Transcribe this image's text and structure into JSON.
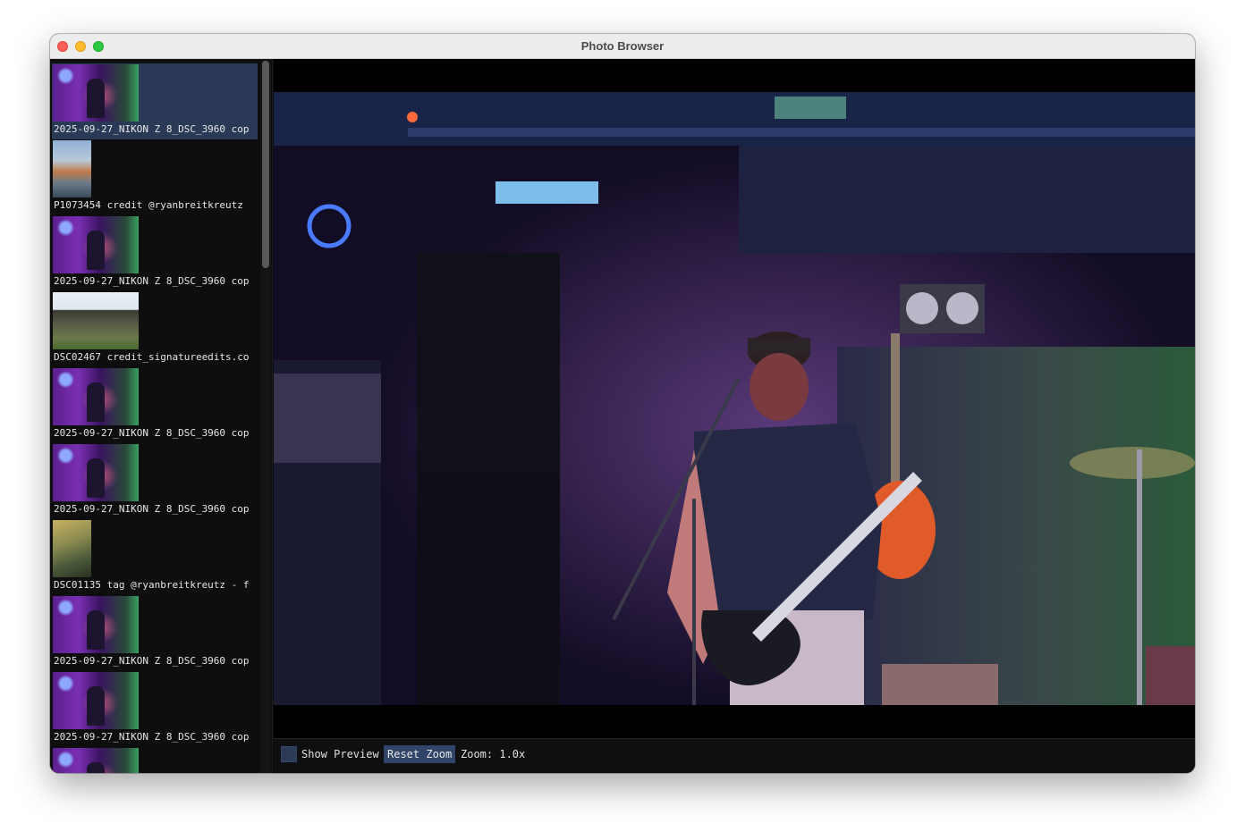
{
  "window": {
    "title": "Photo Browser"
  },
  "sidebar": {
    "items": [
      {
        "label": "2025-09-27_NIKON Z 8_DSC_3960 cop",
        "thumb": "concert",
        "selected": true
      },
      {
        "label": "P1073454 credit @ryanbreitkreutz",
        "thumb": "mountain",
        "selected": false
      },
      {
        "label": "2025-09-27_NIKON Z 8_DSC_3960 cop",
        "thumb": "concert",
        "selected": false
      },
      {
        "label": "DSC02467 credit_signatureedits.co",
        "thumb": "temple",
        "selected": false
      },
      {
        "label": "2025-09-27_NIKON Z 8_DSC_3960 cop",
        "thumb": "concert",
        "selected": false
      },
      {
        "label": "2025-09-27_NIKON Z 8_DSC_3960 cop",
        "thumb": "concert",
        "selected": false
      },
      {
        "label": "DSC01135 tag @ryanbreitkreutz - f",
        "thumb": "forest",
        "selected": false
      },
      {
        "label": "2025-09-27_NIKON Z 8_DSC_3960 cop",
        "thumb": "concert",
        "selected": false
      },
      {
        "label": "2025-09-27_NIKON Z 8_DSC_3960 cop",
        "thumb": "concert",
        "selected": false
      },
      {
        "label": "",
        "thumb": "concert",
        "selected": false
      }
    ]
  },
  "viewer": {
    "image_description_icon": "concert-photo"
  },
  "bottombar": {
    "show_preview_label": "Show Preview",
    "show_preview_checked": false,
    "reset_zoom_label": "Reset Zoom",
    "zoom_text": "Zoom: 1.0x"
  },
  "colors": {
    "selection": "#2a3a56",
    "button": "#2f4468",
    "background": "#0d0d0d"
  }
}
